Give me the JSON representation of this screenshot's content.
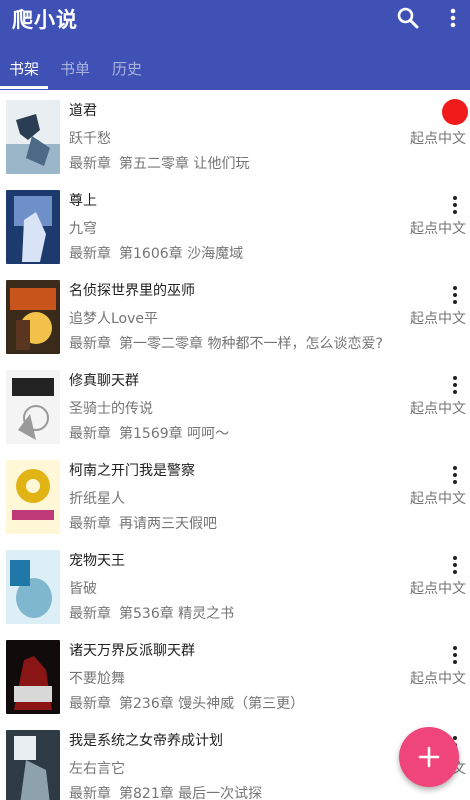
{
  "app": {
    "title": "爬小说"
  },
  "toolbar": {
    "search_icon": "search-icon",
    "more_icon": "more-vert-icon"
  },
  "tabs": [
    {
      "label": "书架",
      "active": true
    },
    {
      "label": "书单",
      "active": false
    },
    {
      "label": "历史",
      "active": false
    }
  ],
  "latest_label": "最新章",
  "books": [
    {
      "title": "道君",
      "author": "跃千愁",
      "latest": "第五二零章 让他们玩",
      "source": "起点中文",
      "cover_colors": [
        "#e8eef2",
        "#9bb6c8",
        "#2a3d52"
      ],
      "badge": "red-dot"
    },
    {
      "title": "尊上",
      "author": "九穹",
      "latest": "第1606章 沙海魔域",
      "source": "起点中文",
      "cover_colors": [
        "#1d3a6e",
        "#6f8fc9",
        "#d8e3f5"
      ]
    },
    {
      "title": "名侦探世界里的巫师",
      "author": "追梦人Love平",
      "latest": "第一零二零章 物种都不一样，怎么谈恋爱?",
      "source": "起点中文",
      "cover_colors": [
        "#3a2a1a",
        "#c9541b",
        "#f2c14a"
      ]
    },
    {
      "title": "修真聊天群",
      "author": "圣骑士的传说",
      "latest": "第1569章 呵呵～",
      "source": "起点中文",
      "cover_colors": [
        "#f4f4f4",
        "#222222",
        "#9a9a9a"
      ]
    },
    {
      "title": "柯南之开门我是警察",
      "author": "折纸星人",
      "latest": "再请两三天假吧",
      "source": "起点中文",
      "cover_colors": [
        "#fff7d6",
        "#e2b315",
        "#c03a7a"
      ]
    },
    {
      "title": "宠物天王",
      "author": "皆破",
      "latest": "第536章 精灵之书",
      "source": "起点中文",
      "cover_colors": [
        "#dceff6",
        "#7fb7cf",
        "#1f78a8"
      ]
    },
    {
      "title": "诸天万界反派聊天群",
      "author": "不要尬舞",
      "latest": "第236章 馒头神威（第三更）",
      "source": "起点中文",
      "cover_colors": [
        "#120b0b",
        "#8a1515",
        "#d8d8d8"
      ]
    },
    {
      "title": "我是系统之女帝养成计划",
      "author": "左右言它",
      "latest": "第821章 最后一次试探",
      "source": "起点中文",
      "cover_colors": [
        "#2e3b44",
        "#8ea2ae",
        "#e8eef1"
      ]
    }
  ],
  "fab": {
    "icon": "plus-icon"
  }
}
